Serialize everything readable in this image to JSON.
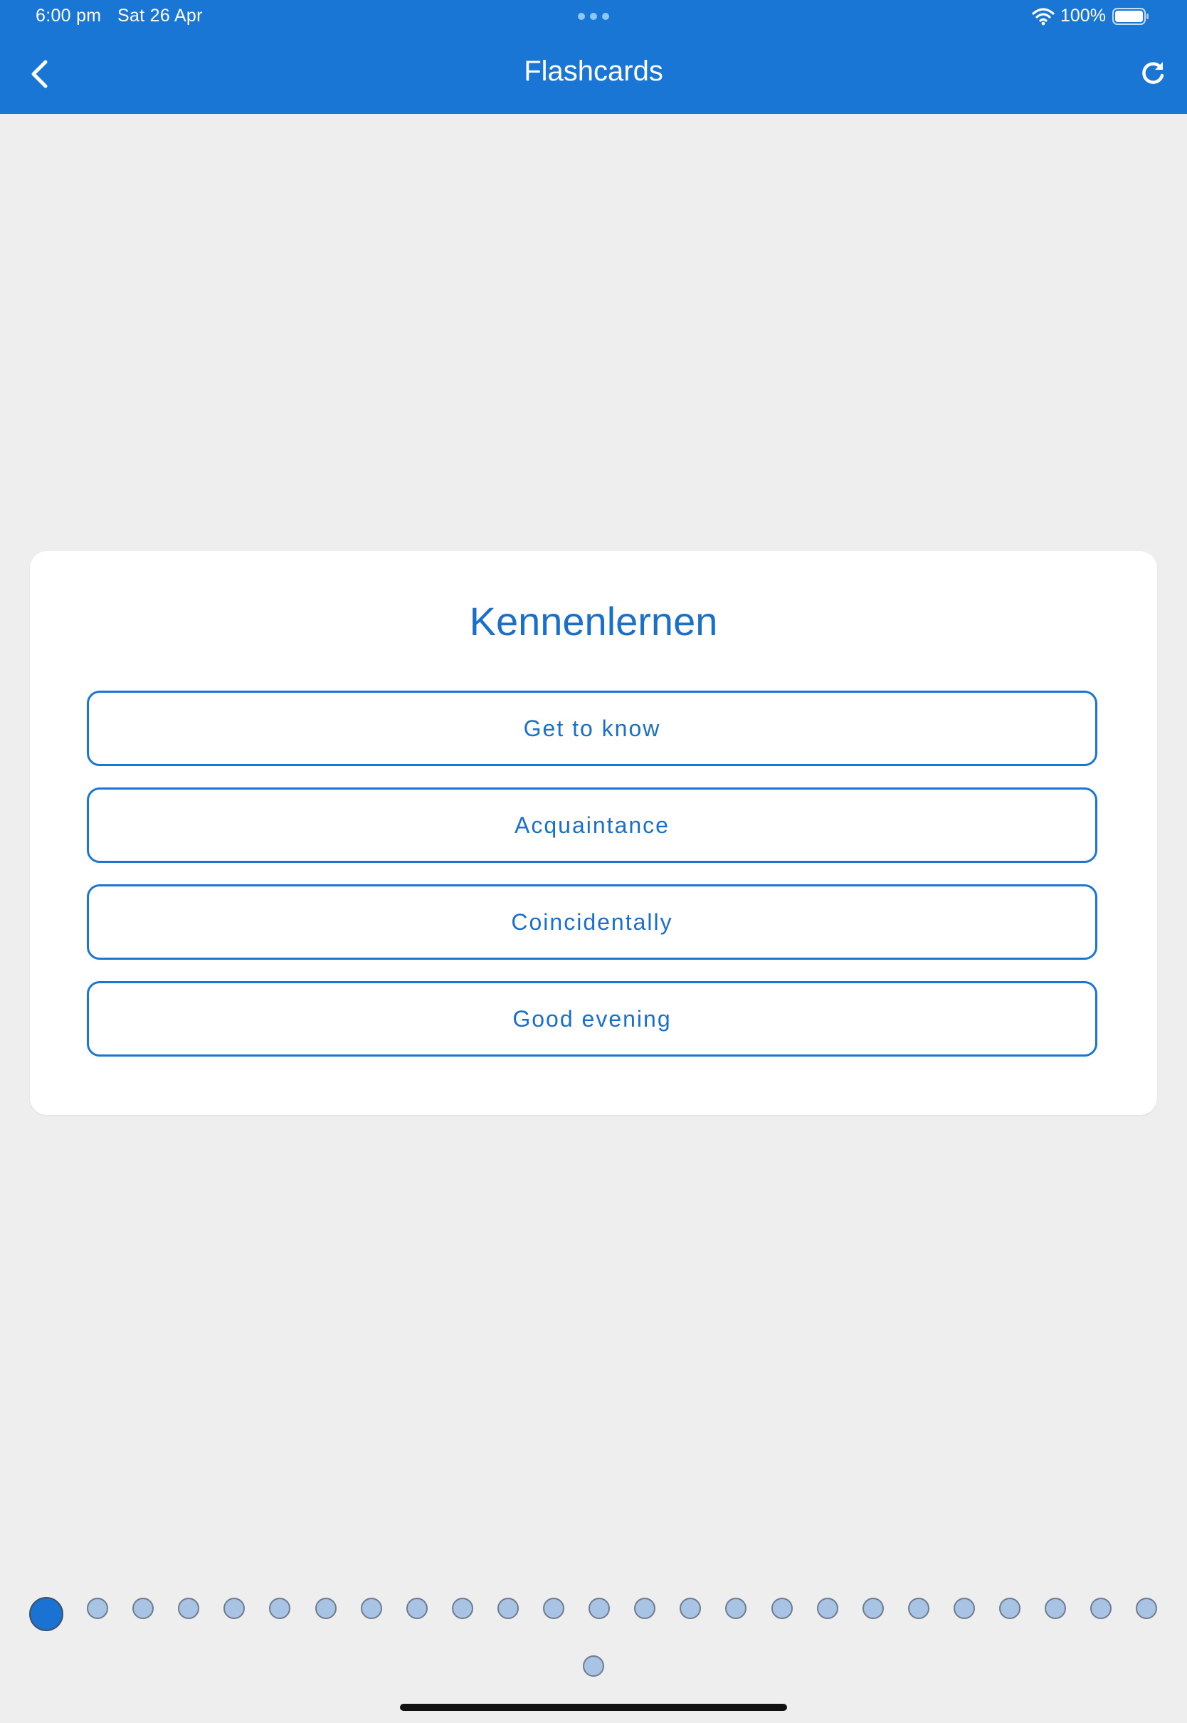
{
  "status_bar": {
    "time": "6:00 pm",
    "date": "Sat 26 Apr",
    "battery_percent": "100%",
    "icons": [
      "multitasking-dots-icon",
      "wifi-icon",
      "battery-icon"
    ]
  },
  "header": {
    "title": "Flashcards",
    "back_icon": "chevron-left-icon",
    "refresh_icon": "refresh-icon",
    "background_color": "#1976d4"
  },
  "card": {
    "word": "Kennenlernen",
    "options": [
      {
        "label": "Get to know"
      },
      {
        "label": "Acquaintance"
      },
      {
        "label": "Coincidentally"
      },
      {
        "label": "Good evening"
      }
    ]
  },
  "pagination": {
    "total": 26,
    "current": 1,
    "active_color": "#1a72d2",
    "inactive_color": "#a9c3e4"
  }
}
